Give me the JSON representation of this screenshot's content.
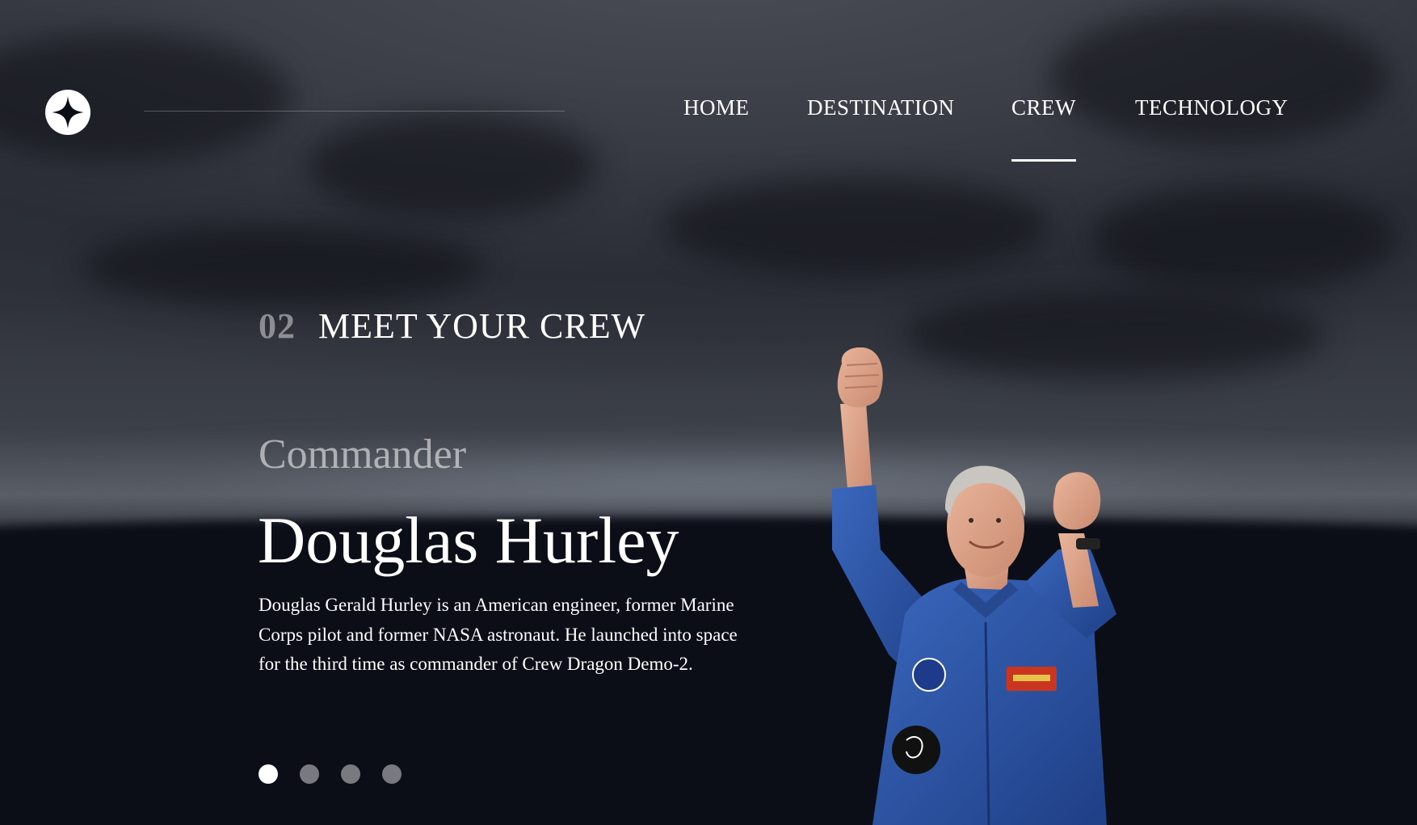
{
  "nav": {
    "items": [
      {
        "label": "HOME",
        "active": false
      },
      {
        "label": "DESTINATION",
        "active": false
      },
      {
        "label": "CREW",
        "active": true
      },
      {
        "label": "TECHNOLOGY",
        "active": false
      }
    ]
  },
  "logo": {
    "icon": "star-logo-icon"
  },
  "section": {
    "number": "02",
    "title": "MEET YOUR CREW"
  },
  "crew_member": {
    "role": "Commander",
    "name": "Douglas Hurley",
    "bio": "Douglas Gerald Hurley is an American engineer, former Marine Corps pilot and former NASA astronaut. He launched into space for the third time as commander of Crew Dragon Demo-2.",
    "image": "astronaut-portrait"
  },
  "pagination": {
    "count": 4,
    "active_index": 0
  },
  "colors": {
    "background": "#0b0d17",
    "text": "#ffffff",
    "muted": "#8a8b90",
    "suit_blue": "#2d56a8"
  }
}
